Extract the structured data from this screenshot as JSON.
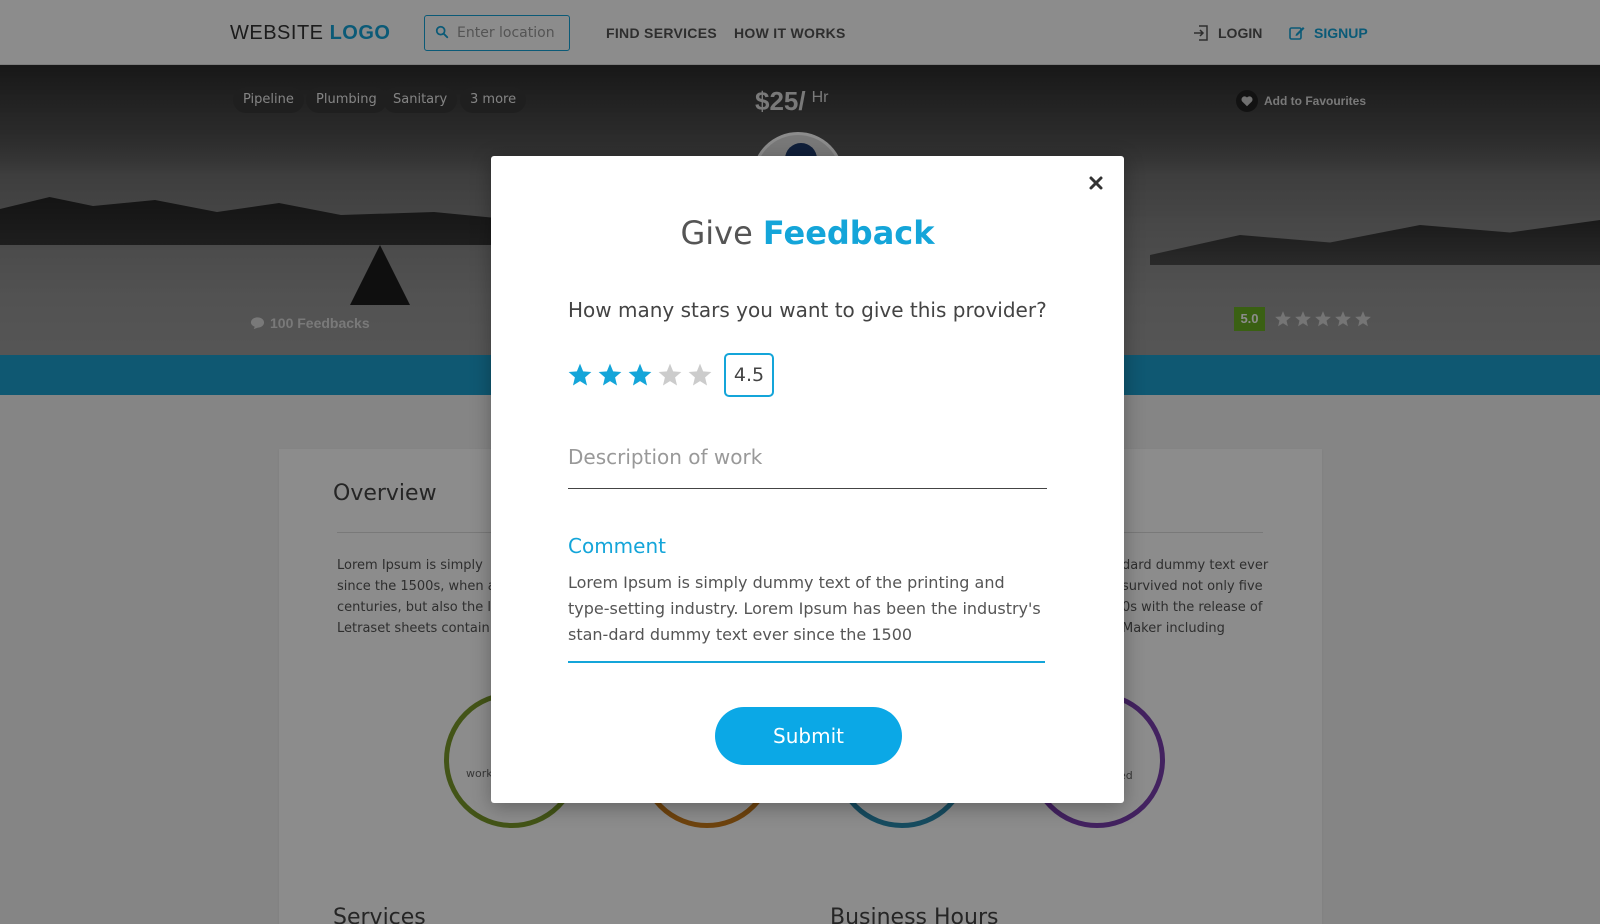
{
  "header": {
    "logo_main": "WEBSITE",
    "logo_accent": "LOGO",
    "search_placeholder": "Enter location",
    "nav": {
      "find_services": "FIND SERVICES",
      "how_it_works": "HOW IT WORKS"
    },
    "login": "LOGIN",
    "signup": "SIGNUP"
  },
  "hero": {
    "tags": [
      "Pipeline",
      "Plumbing",
      "Sanitary",
      "3 more"
    ],
    "price": "$25/",
    "price_unit": "Hr",
    "favourite": "Add to Favourites",
    "feedbacks": "100 Feedbacks",
    "rating": "5.0",
    "rating_stars": 5
  },
  "card": {
    "overview_title": "Overview",
    "overview_left": "Lorem Ipsum is simply",
    "overview_left_2": "since the 1500s, when a",
    "overview_left_3": "centuries, but also the l",
    "overview_left_4": "Letraset sheets contain",
    "overview_right": "dard dummy text ever",
    "overview_right_2": "survived not only five",
    "overview_right_3": "0s with the release of",
    "overview_right_4": "Maker including",
    "ring_label_left": "work",
    "ring_label_right": "ed",
    "services_title": "Services",
    "hours_title": "Business Hours",
    "colors": {
      "ring1": "#7a9a2a",
      "ring2": "#c97a1a",
      "ring3": "#2a8ab0",
      "ring4": "#7a3fb0"
    }
  },
  "modal": {
    "title_main": "Give",
    "title_accent": "Feedback",
    "question": "How many stars you want to give this provider?",
    "stars_filled": 3,
    "stars_total": 5,
    "score": "4.5",
    "description_placeholder": "Description of work",
    "comment_label": "Comment",
    "comment_value": "Lorem Ipsum is simply dummy text of the printing and type-setting industry. Lorem Ipsum has been the industry's stan-dard dummy text ever since the 1500",
    "submit": "Submit",
    "colors": {
      "accent": "#14a5d9",
      "star_filled": "#14a5d9",
      "star_empty": "#cccccc"
    }
  }
}
